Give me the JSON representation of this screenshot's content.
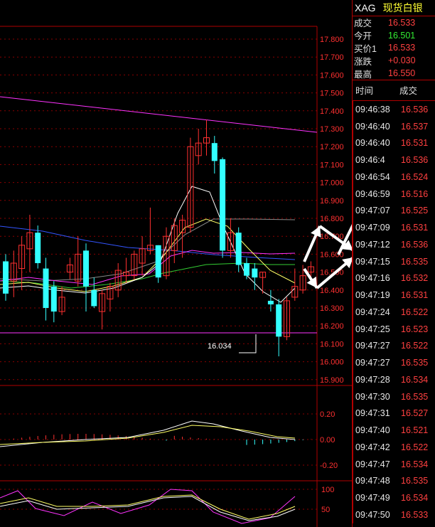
{
  "header": {
    "symbol": "XAG",
    "name": "现货白银"
  },
  "quote": [
    {
      "label": "成交",
      "value": "16.533",
      "color": "red"
    },
    {
      "label": "今开",
      "value": "16.501",
      "color": "green"
    },
    {
      "label": "买价1",
      "value": "16.533",
      "color": "red"
    },
    {
      "label": "涨跌",
      "value": "+0.030",
      "color": "red"
    },
    {
      "label": "最高",
      "value": "16.550",
      "color": "red"
    }
  ],
  "ticks_header": {
    "time": "时间",
    "price": "成交"
  },
  "ticks": [
    {
      "time": "09:46:38",
      "price": "16.536"
    },
    {
      "time": "09:46:40",
      "price": "16.537"
    },
    {
      "time": "09:46:40",
      "price": "16.531"
    },
    {
      "time": "09:46:4",
      "price": "16.536"
    },
    {
      "time": "09:46:54",
      "price": "16.524"
    },
    {
      "time": "09:46:59",
      "price": "16.516"
    },
    {
      "time": "09:47:07",
      "price": "16.525"
    },
    {
      "time": "09:47:09",
      "price": "16.531"
    },
    {
      "time": "09:47:12",
      "price": "16.536"
    },
    {
      "time": "09:47:15",
      "price": "16.535"
    },
    {
      "time": "09:47:16",
      "price": "16.532"
    },
    {
      "time": "09:47:19",
      "price": "16.531"
    },
    {
      "time": "09:47:24",
      "price": "16.522"
    },
    {
      "time": "09:47:25",
      "price": "16.523"
    },
    {
      "time": "09:47:27",
      "price": "16.522"
    },
    {
      "time": "09:47:27",
      "price": "16.535"
    },
    {
      "time": "09:47:28",
      "price": "16.534"
    },
    {
      "time": "09:47:30",
      "price": "16.535"
    },
    {
      "time": "09:47:31",
      "price": "16.527"
    },
    {
      "time": "09:47:40",
      "price": "16.521"
    },
    {
      "time": "09:47:42",
      "price": "16.522"
    },
    {
      "time": "09:47:47",
      "price": "16.534"
    },
    {
      "time": "09:47:48",
      "price": "16.535"
    },
    {
      "time": "09:47:49",
      "price": "16.534"
    },
    {
      "time": "09:47:50",
      "price": "16.533"
    }
  ],
  "price_axis": [
    "17.800",
    "17.700",
    "17.600",
    "17.500",
    "17.400",
    "17.300",
    "17.200",
    "17.100",
    "17.000",
    "16.900",
    "16.800",
    "16.700",
    "16.600",
    "16.500",
    "16.400",
    "16.300",
    "16.200",
    "16.100",
    "16.000",
    "15.900"
  ],
  "macd_axis": [
    "0.20",
    "0.00",
    "-0.20"
  ],
  "kdj_axis": [
    "100",
    "50"
  ],
  "low_label": "16.034",
  "chart_data": {
    "type": "candlestick",
    "price_range": [
      15.9,
      17.85
    ],
    "candles": [
      {
        "o": 16.56,
        "h": 16.6,
        "l": 16.34,
        "c": 16.38
      },
      {
        "o": 16.45,
        "h": 16.62,
        "l": 16.36,
        "c": 16.55
      },
      {
        "o": 16.52,
        "h": 16.7,
        "l": 16.4,
        "c": 16.65
      },
      {
        "o": 16.63,
        "h": 16.82,
        "l": 16.5,
        "c": 16.72
      },
      {
        "o": 16.72,
        "h": 16.76,
        "l": 16.52,
        "c": 16.55
      },
      {
        "o": 16.52,
        "h": 16.58,
        "l": 16.23,
        "c": 16.3
      },
      {
        "o": 16.42,
        "h": 16.45,
        "l": 16.22,
        "c": 16.28
      },
      {
        "o": 16.28,
        "h": 16.42,
        "l": 16.26,
        "c": 16.36
      },
      {
        "o": 16.5,
        "h": 16.58,
        "l": 16.46,
        "c": 16.54
      },
      {
        "o": 16.45,
        "h": 16.7,
        "l": 16.42,
        "c": 16.6
      },
      {
        "o": 16.62,
        "h": 16.66,
        "l": 16.28,
        "c": 16.42
      },
      {
        "o": 16.4,
        "h": 16.47,
        "l": 16.3,
        "c": 16.31
      },
      {
        "o": 16.28,
        "h": 16.4,
        "l": 16.18,
        "c": 16.38
      },
      {
        "o": 16.35,
        "h": 16.44,
        "l": 16.28,
        "c": 16.42
      },
      {
        "o": 16.4,
        "h": 16.55,
        "l": 16.36,
        "c": 16.51
      },
      {
        "o": 16.48,
        "h": 16.58,
        "l": 16.44,
        "c": 16.5
      },
      {
        "o": 16.48,
        "h": 16.62,
        "l": 16.46,
        "c": 16.6
      },
      {
        "o": 16.55,
        "h": 16.7,
        "l": 16.48,
        "c": 16.63
      },
      {
        "o": 16.62,
        "h": 16.86,
        "l": 16.6,
        "c": 16.65
      },
      {
        "o": 16.65,
        "h": 16.65,
        "l": 16.44,
        "c": 16.47
      },
      {
        "o": 16.48,
        "h": 16.75,
        "l": 16.46,
        "c": 16.7
      },
      {
        "o": 16.62,
        "h": 16.8,
        "l": 16.55,
        "c": 16.76
      },
      {
        "o": 16.72,
        "h": 16.82,
        "l": 16.58,
        "c": 16.79
      },
      {
        "o": 16.75,
        "h": 17.25,
        "l": 16.72,
        "c": 17.2
      },
      {
        "o": 17.15,
        "h": 17.3,
        "l": 17.1,
        "c": 17.22
      },
      {
        "o": 17.22,
        "h": 17.35,
        "l": 17.15,
        "c": 17.25
      },
      {
        "o": 17.22,
        "h": 17.26,
        "l": 17.05,
        "c": 17.12
      },
      {
        "o": 17.13,
        "h": 17.14,
        "l": 16.58,
        "c": 16.62
      },
      {
        "o": 16.62,
        "h": 16.8,
        "l": 16.58,
        "c": 16.72
      },
      {
        "o": 16.72,
        "h": 16.75,
        "l": 16.5,
        "c": 16.54
      },
      {
        "o": 16.55,
        "h": 16.58,
        "l": 16.46,
        "c": 16.48
      },
      {
        "o": 16.52,
        "h": 16.55,
        "l": 16.4,
        "c": 16.47
      },
      {
        "o": 16.47,
        "h": 16.5,
        "l": 16.38,
        "c": 16.5
      },
      {
        "o": 16.34,
        "h": 16.4,
        "l": 16.28,
        "c": 16.32
      },
      {
        "o": 16.32,
        "h": 16.35,
        "l": 16.03,
        "c": 16.14
      },
      {
        "o": 16.14,
        "h": 16.36,
        "l": 16.12,
        "c": 16.34
      },
      {
        "o": 16.36,
        "h": 16.52,
        "l": 16.34,
        "c": 16.42
      },
      {
        "o": 16.4,
        "h": 16.54,
        "l": 16.38,
        "c": 16.48
      },
      {
        "o": 16.5,
        "h": 16.56,
        "l": 16.46,
        "c": 16.53
      }
    ]
  }
}
